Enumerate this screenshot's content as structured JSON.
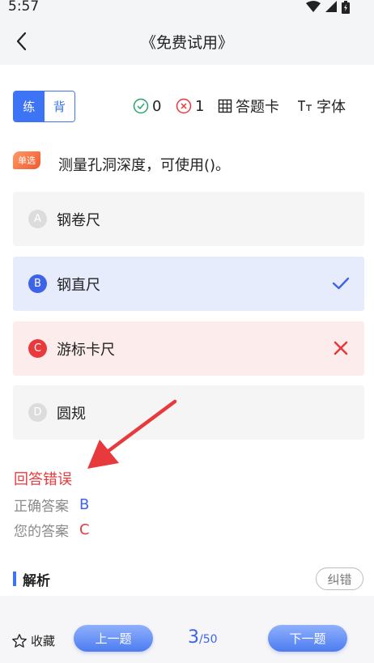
{
  "status": {
    "time": "5:57"
  },
  "header": {
    "title": "《免费试用》"
  },
  "mode": {
    "practice": "练",
    "recite": "背"
  },
  "stats": {
    "correct": "0",
    "wrong": "1",
    "answer_card": "答题卡",
    "font": "字体"
  },
  "question": {
    "type_badge": "单选",
    "text": "测量孔洞深度，可使用()。"
  },
  "options": [
    {
      "letter": "A",
      "text": "钢卷尺",
      "state": "normal"
    },
    {
      "letter": "B",
      "text": "钢直尺",
      "state": "correct"
    },
    {
      "letter": "C",
      "text": "游标卡尺",
      "state": "wrong"
    },
    {
      "letter": "D",
      "text": "圆规",
      "state": "normal"
    }
  ],
  "result": {
    "title": "回答错误",
    "correct_label": "正确答案",
    "correct_value": "B",
    "yours_label": "您的答案",
    "yours_value": "C"
  },
  "analysis": {
    "title": "解析",
    "report": "纠错"
  },
  "footer": {
    "favorite": "收藏",
    "prev": "上一题",
    "current": "3",
    "total": "/50",
    "next": "下一题"
  },
  "colors": {
    "accent": "#3d74f5",
    "correct": "#3d64e8",
    "wrong": "#e8393c"
  },
  "icons": [
    "wifi-icon",
    "signal-icon",
    "battery-icon",
    "back-arrow-icon",
    "check-circle-icon",
    "x-circle-icon",
    "grid-icon",
    "font-size-icon",
    "checkmark-icon",
    "cross-icon",
    "star-icon",
    "annotation-arrow"
  ]
}
